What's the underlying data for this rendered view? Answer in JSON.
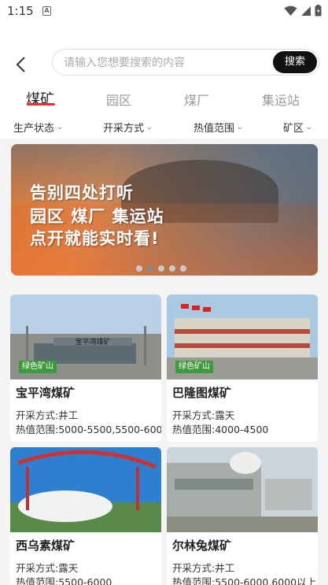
{
  "status": {
    "time": "1:15",
    "a_icon": "A"
  },
  "search": {
    "placeholder": "请输入您想要搜索的内容",
    "button_label": "搜索"
  },
  "tabs": [
    {
      "label": "煤矿",
      "active": true
    },
    {
      "label": "园区",
      "active": false
    },
    {
      "label": "煤厂",
      "active": false
    },
    {
      "label": "集运站",
      "active": false
    }
  ],
  "filters": [
    {
      "label": "生产状态"
    },
    {
      "label": "开采方式"
    },
    {
      "label": "热值范围"
    },
    {
      "label": "矿区"
    }
  ],
  "banner": {
    "line1": "告别四处打听",
    "line2": "园区  煤厂  集运站",
    "line3": "点开就能实时看!",
    "slides": 5,
    "active_slide": 2
  },
  "cards": [
    {
      "title": "宝平湾煤矿",
      "tag": "绿色矿山",
      "mining": "开采方式:井工",
      "heat": "热值范围:5000-5500,5500-600"
    },
    {
      "title": "巴隆图煤矿",
      "tag": "绿色矿山",
      "mining": "开采方式:露天",
      "heat": "热值范围:4000-4500"
    },
    {
      "title": "西乌素煤矿",
      "tag": "",
      "mining": "开采方式:露天",
      "heat": "热值范围:5500-6000"
    },
    {
      "title": "尔林兔煤矿",
      "tag": "",
      "mining": "开采方式:井工",
      "heat": "热值范围:5500-6000,6000以上"
    }
  ],
  "colors": {
    "accent": "#dd3333",
    "search_button": "#111111",
    "tag_green": "#3d9a3d"
  }
}
